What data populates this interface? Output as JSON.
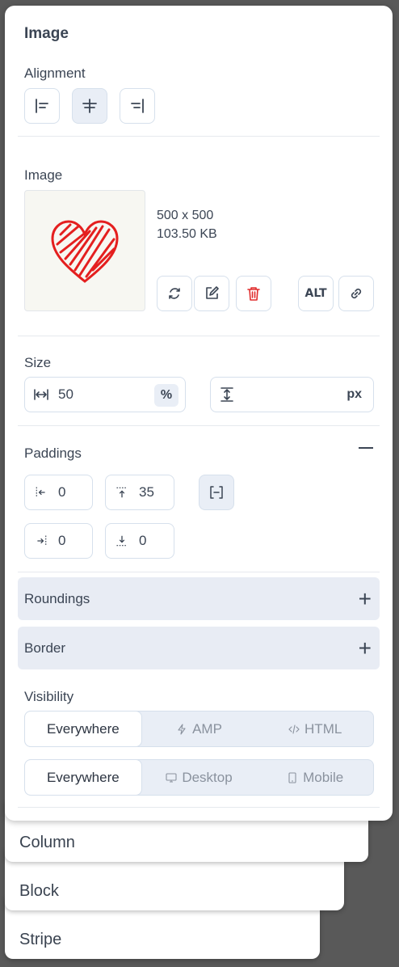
{
  "panel": {
    "title": "Image",
    "alignment": {
      "label": "Alignment",
      "options": [
        "align-left",
        "align-center",
        "align-right"
      ],
      "selected": "align-center"
    },
    "image": {
      "label": "Image",
      "dimensions": "500 x 500",
      "file_size": "103.50 KB",
      "actions": {
        "replace": "replace-icon",
        "edit": "edit-icon",
        "delete": "trash-icon",
        "alt": "ALT",
        "link": "link-icon"
      }
    },
    "size": {
      "label": "Size",
      "width_value": "50",
      "width_unit": "%",
      "height_value": "",
      "height_unit": "px"
    },
    "paddings": {
      "label": "Paddings",
      "left": "0",
      "top": "35",
      "right": "0",
      "bottom": "0"
    },
    "roundings": {
      "label": "Roundings"
    },
    "border": {
      "label": "Border"
    },
    "visibility": {
      "label": "Visibility",
      "format_options": [
        "Everywhere",
        "AMP",
        "HTML"
      ],
      "format_selected": "Everywhere",
      "device_options": [
        "Everywhere",
        "Desktop",
        "Mobile"
      ],
      "device_selected": "Everywhere"
    }
  },
  "stack": {
    "column": "Column",
    "block": "Block",
    "stripe": "Stripe"
  },
  "colors": {
    "delete": "#e02b2b",
    "heart": "#e41f1f",
    "accent_bg": "#e9eef6"
  }
}
